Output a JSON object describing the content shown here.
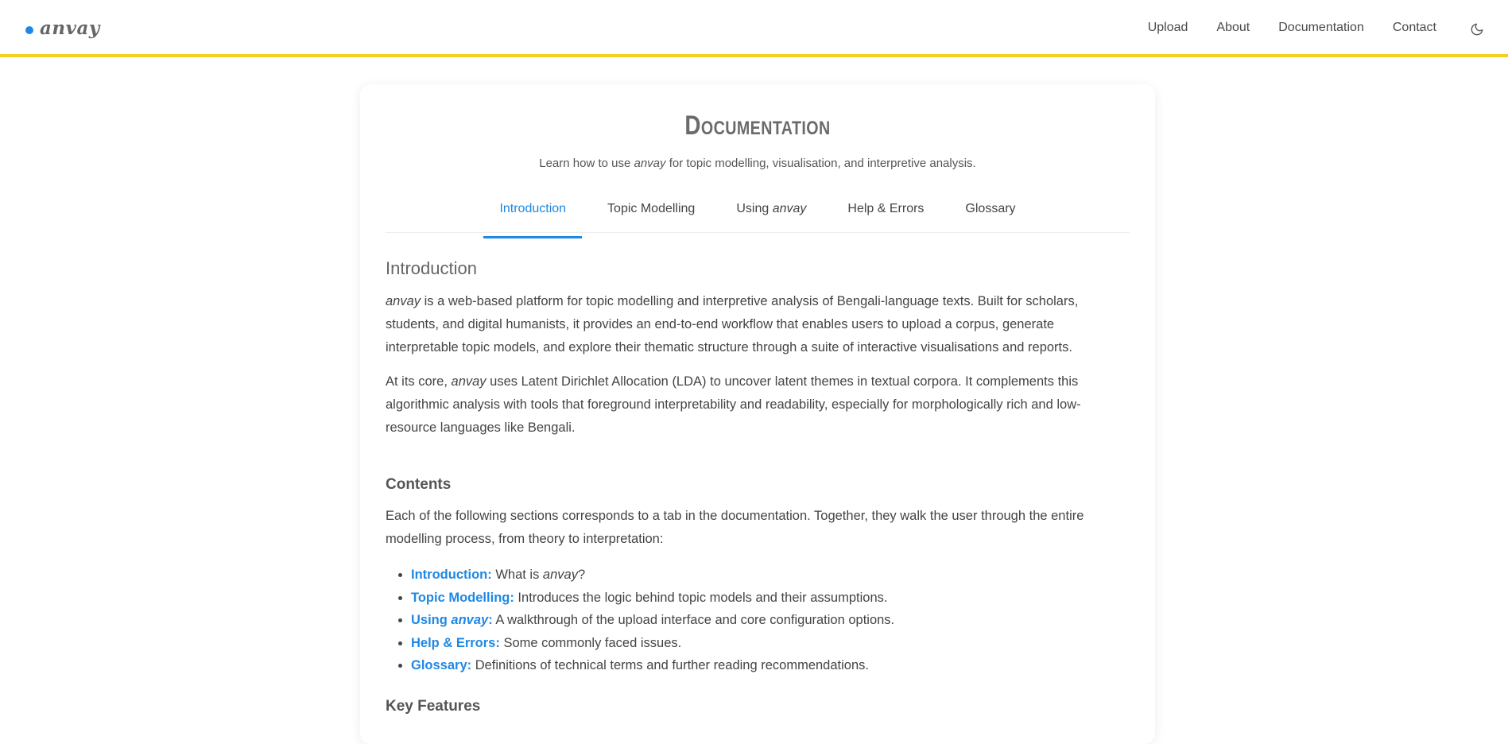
{
  "brand": {
    "name": "anvay",
    "accent": "#1e88e5",
    "bar_color": "#f5cf25"
  },
  "nav": {
    "items": [
      "Upload",
      "About",
      "Documentation",
      "Contact"
    ],
    "theme_icon": "moon-icon"
  },
  "page": {
    "title": "Documentation",
    "subtitle_pre": "Learn how to use ",
    "subtitle_em": "anvay",
    "subtitle_post": " for topic modelling, visualisation, and interpretive analysis."
  },
  "tabs": [
    {
      "label": "Introduction",
      "active": true
    },
    {
      "label": "Topic Modelling",
      "active": false
    },
    {
      "label_pre": "Using ",
      "label_em": "anvay",
      "active": false
    },
    {
      "label": "Help & Errors",
      "active": false
    },
    {
      "label": "Glossary",
      "active": false
    }
  ],
  "intro": {
    "heading": "Introduction",
    "p1_em": "anvay",
    "p1_rest": " is a web-based platform for topic modelling and interpretive analysis of Bengali-language texts. Built for scholars, students, and digital humanists, it provides an end-to-end workflow that enables users to upload a corpus, generate interpretable topic models, and explore their thematic structure through a suite of interactive visualisations and reports.",
    "p2_pre": "At its core, ",
    "p2_em": "anvay",
    "p2_rest": " uses Latent Dirichlet Allocation (LDA) to uncover latent themes in textual corpora. It complements this algorithmic analysis with tools that foreground interpretability and readability, especially for morphologically rich and low-resource languages like Bengali."
  },
  "contents": {
    "heading": "Contents",
    "description": "Each of the following sections corresponds to a tab in the documentation. Together, they walk the user through the entire modelling process, from theory to interpretation:",
    "items": [
      {
        "link": "Introduction:",
        "desc_pre": " What is ",
        "desc_em": "anvay",
        "desc_post": "?"
      },
      {
        "link": "Topic Modelling:",
        "desc_pre": " Introduces the logic behind topic models and their assumptions.",
        "desc_em": "",
        "desc_post": ""
      },
      {
        "link_pre": "Using ",
        "link_em": "anvay",
        "link_post": ":",
        "desc_pre": " A walkthrough of the upload interface and core configuration options.",
        "desc_em": "",
        "desc_post": ""
      },
      {
        "link": "Help & Errors:",
        "desc_pre": " Some commonly faced issues.",
        "desc_em": "",
        "desc_post": ""
      },
      {
        "link": "Glossary:",
        "desc_pre": " Definitions of technical terms and further reading recommendations.",
        "desc_em": "",
        "desc_post": ""
      }
    ]
  },
  "key_features": {
    "heading": "Key Features"
  }
}
